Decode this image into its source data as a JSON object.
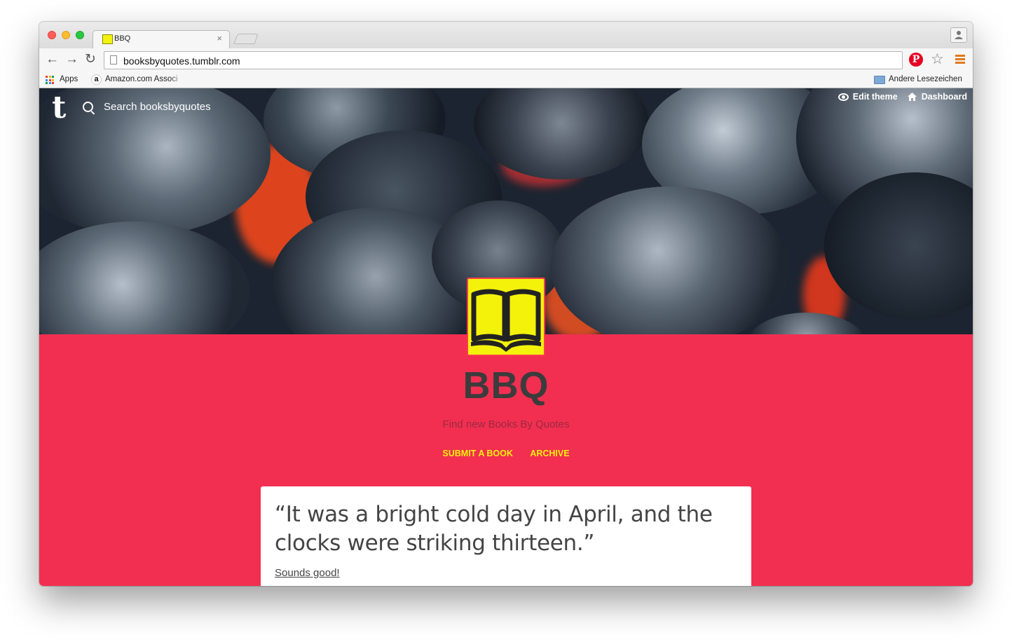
{
  "browser": {
    "tab_title": "BBQ",
    "tab_close": "×",
    "url": "booksbyquotes.tumblr.com",
    "nav": {
      "back": "←",
      "forward": "→",
      "reload": "↻"
    },
    "bookmarks": {
      "apps": "Apps",
      "amazon": "Amazon.com Associ",
      "amazon_glyph": "a",
      "other": "Andere Lesezeichen"
    },
    "pinterest_glyph": "P",
    "star_glyph": "☆"
  },
  "tumblr_bar": {
    "logo": "t",
    "search_placeholder": "Search booksbyquotes",
    "edit_theme": "Edit theme",
    "dashboard": "Dashboard"
  },
  "blog": {
    "title": "BBQ",
    "description": "Find new Books By Quotes",
    "nav": [
      "SUBMIT A BOOK",
      "ARCHIVE"
    ],
    "accent_color": "#f22f51",
    "link_color": "#f4f20b"
  },
  "post": {
    "quote": "“It was a bright cold day in April, and the clocks were striking thirteen.”",
    "source": "Sounds good!"
  }
}
